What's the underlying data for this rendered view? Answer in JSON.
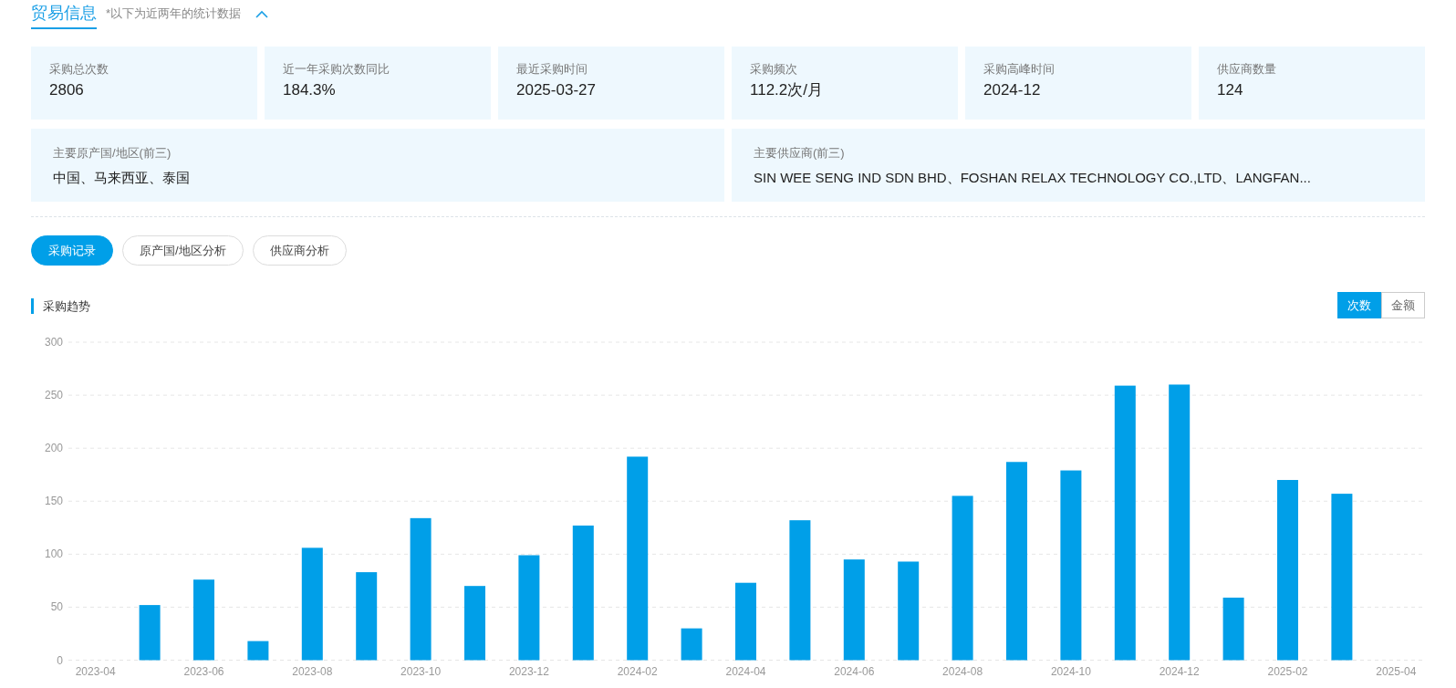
{
  "header": {
    "title": "贸易信息",
    "note": "*以下为近两年的统计数据",
    "expanded": true
  },
  "stats": [
    {
      "label": "采购总次数",
      "value": "2806"
    },
    {
      "label": "近一年采购次数同比",
      "value": "184.3%"
    },
    {
      "label": "最近采购时间",
      "value": "2025-03-27"
    },
    {
      "label": "采购频次",
      "value": "112.2次/月"
    },
    {
      "label": "采购高峰时间",
      "value": "2024-12"
    },
    {
      "label": "供应商数量",
      "value": "124"
    }
  ],
  "highlights": [
    {
      "label": "主要原产国/地区(前三)",
      "value": "中国、马来西亚、泰国"
    },
    {
      "label": "主要供应商(前三)",
      "value": "SIN WEE SENG IND SDN BHD、FOSHAN RELAX TECHNOLOGY CO.,LTD、LANGFAN..."
    }
  ],
  "tabs": [
    {
      "label": "采购记录",
      "selected": true
    },
    {
      "label": "原产国/地区分析",
      "selected": false
    },
    {
      "label": "供应商分析",
      "selected": false
    }
  ],
  "trend": {
    "title": "采购趋势",
    "toggle": [
      {
        "label": "次数",
        "selected": true
      },
      {
        "label": "金额",
        "selected": false
      }
    ],
    "chart_data": {
      "type": "bar",
      "categories": [
        "2023-04",
        null,
        "2023-06",
        null,
        "2023-08",
        null,
        "2023-10",
        null,
        "2023-12",
        null,
        "2024-02",
        null,
        "2024-04",
        null,
        "2024-06",
        null,
        "2024-08",
        null,
        "2024-10",
        null,
        "2024-12",
        null,
        "2025-02",
        null,
        "2025-04"
      ],
      "grid": true,
      "values": [
        null,
        52,
        76,
        18,
        106,
        83,
        134,
        70,
        99,
        127,
        192,
        30,
        73,
        132,
        95,
        93,
        155,
        187,
        179,
        259,
        260,
        59,
        170,
        157,
        null
      ],
      "ylim": [
        0,
        300
      ],
      "yticks": [
        0,
        50,
        100,
        150,
        200,
        250,
        300
      ]
    }
  }
}
